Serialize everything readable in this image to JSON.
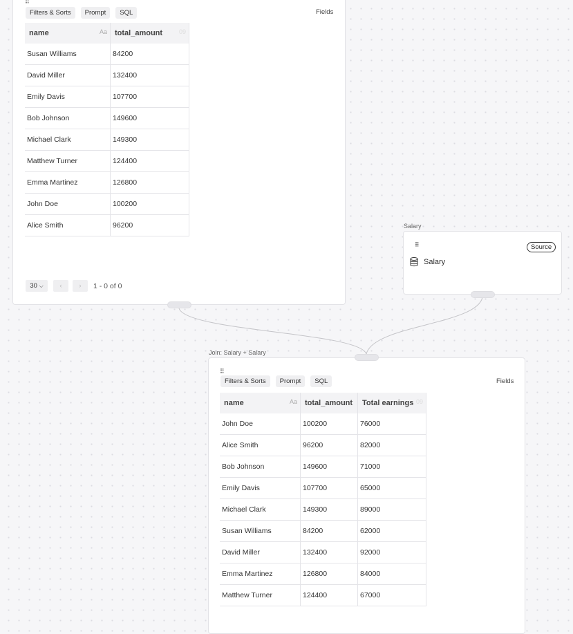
{
  "top_node": {
    "toolbar": {
      "filters_label": "Filters & Sorts",
      "prompt_label": "Prompt",
      "sql_label": "SQL",
      "fields_label": "Fields"
    },
    "columns": [
      {
        "label": "name",
        "type_hint": "Aa"
      },
      {
        "label": "total_amount",
        "type_hint": "09"
      }
    ],
    "rows": [
      [
        "Susan Williams",
        "84200"
      ],
      [
        "David Miller",
        "132400"
      ],
      [
        "Emily Davis",
        "107700"
      ],
      [
        "Bob Johnson",
        "149600"
      ],
      [
        "Michael Clark",
        "149300"
      ],
      [
        "Matthew Turner",
        "124400"
      ],
      [
        "Emma Martinez",
        "126800"
      ],
      [
        "John Doe",
        "100200"
      ],
      [
        "Alice Smith",
        "96200"
      ]
    ],
    "pager": {
      "page_size": "30",
      "prev": "‹",
      "next": "›",
      "range_text": "1 - 0 of 0"
    }
  },
  "salary_node": {
    "label": "Salary",
    "badge": "Source",
    "source_name": "Salary",
    "icon": "database-icon"
  },
  "join_node": {
    "label": "Join: Salary + Salary",
    "toolbar": {
      "filters_label": "Filters & Sorts",
      "prompt_label": "Prompt",
      "sql_label": "SQL",
      "fields_label": "Fields"
    },
    "columns": [
      {
        "label": "name",
        "type_hint": "Aa"
      },
      {
        "label": "total_amount",
        "type_hint": ""
      },
      {
        "label": "Total earnings",
        "type_hint": "09"
      }
    ],
    "rows": [
      [
        "John Doe",
        "100200",
        "76000"
      ],
      [
        "Alice Smith",
        "96200",
        "82000"
      ],
      [
        "Bob Johnson",
        "149600",
        "71000"
      ],
      [
        "Emily Davis",
        "107700",
        "65000"
      ],
      [
        "Michael Clark",
        "149300",
        "89000"
      ],
      [
        "Susan Williams",
        "84200",
        "62000"
      ],
      [
        "David Miller",
        "132400",
        "92000"
      ],
      [
        "Emma Martinez",
        "126800",
        "84000"
      ],
      [
        "Matthew Turner",
        "124400",
        "67000"
      ]
    ]
  }
}
